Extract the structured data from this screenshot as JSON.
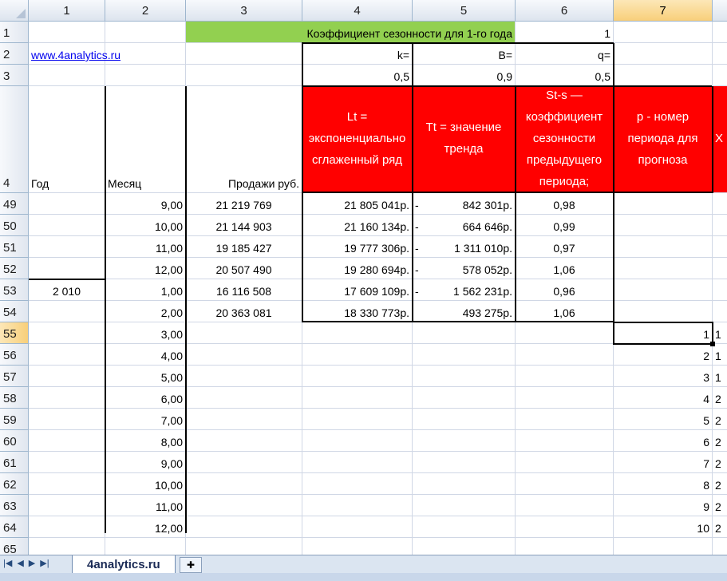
{
  "columns": [
    "1",
    "2",
    "3",
    "4",
    "5",
    "6",
    "7"
  ],
  "selected_column": "7",
  "selected_row": "55",
  "row_labels": {
    "r1": "1",
    "r2": "2",
    "r3": "3",
    "r4": "4",
    "data": [
      "49",
      "50",
      "51",
      "52",
      "53",
      "54",
      "55",
      "56",
      "57",
      "58",
      "59",
      "60",
      "61",
      "62",
      "63",
      "64",
      "65"
    ]
  },
  "row1": {
    "title": "Коэффициент сезонности для 1-го года",
    "value": "1"
  },
  "row2": {
    "link": "www.4analytics.ru",
    "k_label": "k=",
    "b_label": "B=",
    "q_label": "q="
  },
  "row3": {
    "k": "0,5",
    "b": "0,9",
    "q": "0,5"
  },
  "headers": {
    "year": "Год",
    "month": "Месяц",
    "sales": "Продажи руб.",
    "lt": "Lt = экспоненциально сглаженный ряд",
    "tt": "Tt = значение тренда",
    "st": "St-s — коэффициент сезонности предыдущего периода;",
    "p": "p - номер периода для прогноза",
    "col8_partial": "Х"
  },
  "rows": [
    {
      "year": "",
      "month": "9,00",
      "sales": "21 219 769",
      "lt": "21 805 041р.",
      "tt_sign": "-",
      "tt": "842 301р.",
      "st": "0,98",
      "p": ""
    },
    {
      "year": "",
      "month": "10,00",
      "sales": "21 144 903",
      "lt": "21 160 134р.",
      "tt_sign": "-",
      "tt": "664 646р.",
      "st": "0,99",
      "p": ""
    },
    {
      "year": "",
      "month": "11,00",
      "sales": "19 185 427",
      "lt": "19 777 306р.",
      "tt_sign": "-",
      "tt": "1 311 010р.",
      "st": "0,97",
      "p": ""
    },
    {
      "year": "",
      "month": "12,00",
      "sales": "20 507 490",
      "lt": "19 280 694р.",
      "tt_sign": "-",
      "tt": "578 052р.",
      "st": "1,06",
      "p": ""
    },
    {
      "year": "2 010",
      "month": "1,00",
      "sales": "16 116 508",
      "lt": "17 609 109р.",
      "tt_sign": "-",
      "tt": "1 562 231р.",
      "st": "0,96",
      "p": ""
    },
    {
      "year": "",
      "month": "2,00",
      "sales": "20 363 081",
      "lt": "18 330 773р.",
      "tt_sign": "",
      "tt": "493 275р.",
      "st": "1,06",
      "p": ""
    },
    {
      "year": "",
      "month": "3,00",
      "sales": "",
      "lt": "",
      "tt_sign": "",
      "tt": "",
      "st": "",
      "p": "1"
    },
    {
      "year": "",
      "month": "4,00",
      "sales": "",
      "lt": "",
      "tt_sign": "",
      "tt": "",
      "st": "",
      "p": "2"
    },
    {
      "year": "",
      "month": "5,00",
      "sales": "",
      "lt": "",
      "tt_sign": "",
      "tt": "",
      "st": "",
      "p": "3"
    },
    {
      "year": "",
      "month": "6,00",
      "sales": "",
      "lt": "",
      "tt_sign": "",
      "tt": "",
      "st": "",
      "p": "4"
    },
    {
      "year": "",
      "month": "7,00",
      "sales": "",
      "lt": "",
      "tt_sign": "",
      "tt": "",
      "st": "",
      "p": "5"
    },
    {
      "year": "",
      "month": "8,00",
      "sales": "",
      "lt": "",
      "tt_sign": "",
      "tt": "",
      "st": "",
      "p": "6"
    },
    {
      "year": "",
      "month": "9,00",
      "sales": "",
      "lt": "",
      "tt_sign": "",
      "tt": "",
      "st": "",
      "p": "7"
    },
    {
      "year": "",
      "month": "10,00",
      "sales": "",
      "lt": "",
      "tt_sign": "",
      "tt": "",
      "st": "",
      "p": "8"
    },
    {
      "year": "",
      "month": "11,00",
      "sales": "",
      "lt": "",
      "tt_sign": "",
      "tt": "",
      "st": "",
      "p": "9"
    },
    {
      "year": "",
      "month": "12,00",
      "sales": "",
      "lt": "",
      "tt_sign": "",
      "tt": "",
      "st": "",
      "p": "10"
    },
    {
      "year": "",
      "month": "",
      "sales": "",
      "lt": "",
      "tt_sign": "",
      "tt": "",
      "st": "",
      "p": ""
    }
  ],
  "col8_partial_values": [
    "1",
    "1",
    "1",
    "2",
    "2",
    "2",
    "2",
    "2",
    "2",
    "2"
  ],
  "sheet_tab": "4analytics.ru",
  "nav_icons": [
    "first-sheet-icon",
    "prev-sheet-icon",
    "next-sheet-icon",
    "last-sheet-icon"
  ],
  "colors": {
    "header_red": "#ff0000",
    "title_green": "#92d050",
    "selection_orange": "#f8cf7a"
  }
}
